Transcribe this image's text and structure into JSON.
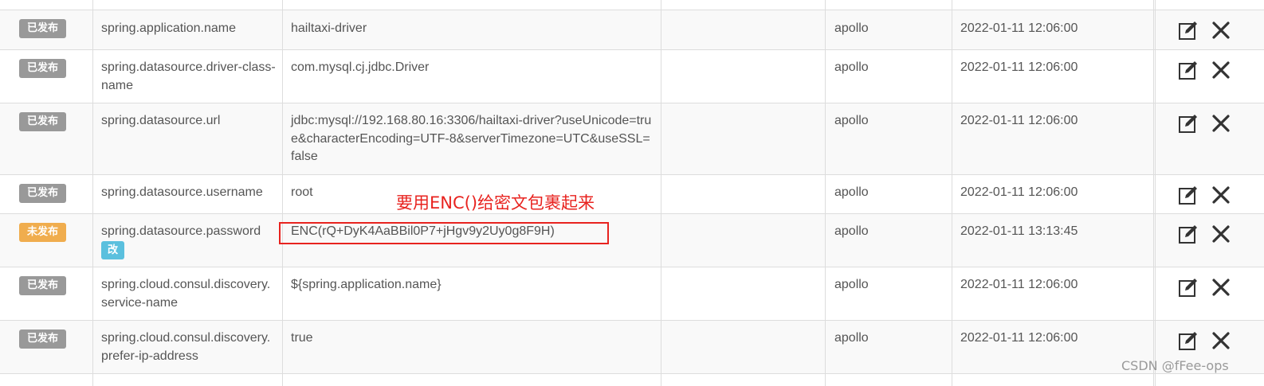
{
  "rows": [
    {
      "status": "已发布",
      "key": "spring.application.name",
      "value": "hailtaxi-driver",
      "user": "apollo",
      "time": "2022-01-11 12:06:00"
    },
    {
      "status": "已发布",
      "key": "spring.datasource.driver-class-name",
      "value": "com.mysql.cj.jdbc.Driver",
      "user": "apollo",
      "time": "2022-01-11 12:06:00"
    },
    {
      "status": "已发布",
      "key": "spring.datasource.url",
      "value": "jdbc:mysql://192.168.80.16:3306/hailtaxi-driver?useUnicode=true&characterEncoding=UTF-8&serverTimezone=UTC&useSSL=false",
      "user": "apollo",
      "time": "2022-01-11 12:06:00"
    },
    {
      "status": "已发布",
      "key": "spring.datasource.username",
      "value": "root",
      "user": "apollo",
      "time": "2022-01-11 12:06:00"
    },
    {
      "status": "未发布",
      "key": "spring.datasource.password",
      "modified_badge": "改",
      "value": "ENC(rQ+DyK4AaBBil0P7+jHgv9y2Uy0g8F9H)",
      "user": "apollo",
      "time": "2022-01-11 13:13:45"
    },
    {
      "status": "已发布",
      "key": "spring.cloud.consul.discovery.service-name",
      "value": "${spring.application.name}",
      "user": "apollo",
      "time": "2022-01-11 12:06:00"
    },
    {
      "status": "已发布",
      "key": "spring.cloud.consul.discovery.prefer-ip-address",
      "value": "true",
      "user": "apollo",
      "time": "2022-01-11 12:06:00"
    }
  ],
  "annotation": "要用ENC()给密文包裹起来",
  "watermark": "CSDN @fFee-ops",
  "colors": {
    "published_badge": "#999999",
    "unpublished_badge": "#f0ad4e",
    "modified_badge": "#5bc0de",
    "annotation": "#e8231f"
  },
  "icons": {
    "edit": "edit-icon",
    "delete": "close-icon"
  }
}
